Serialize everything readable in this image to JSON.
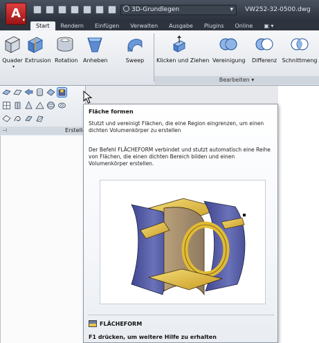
{
  "titlebar": {
    "app_letter": "A",
    "workspace_name": "3D-Grundlegen",
    "document_title": "VW252-32-0500.dwg"
  },
  "tabs": [
    {
      "label": "Start",
      "active": true
    },
    {
      "label": "Rendern",
      "active": false
    },
    {
      "label": "Einfügen",
      "active": false
    },
    {
      "label": "Verwalten",
      "active": false
    },
    {
      "label": "Ausgabe",
      "active": false
    },
    {
      "label": "Plugins",
      "active": false
    },
    {
      "label": "Online",
      "active": false
    },
    {
      "label": "▣ ▾",
      "active": false
    }
  ],
  "ribbon": {
    "buttons": [
      {
        "label": "Quader",
        "icon": "box-icon"
      },
      {
        "label": "Extrusion",
        "icon": "extrude-icon"
      },
      {
        "label": "Rotation",
        "icon": "revolve-icon"
      },
      {
        "label": "Anheben",
        "icon": "loft-icon"
      },
      {
        "label": "Sweep",
        "icon": "sweep-icon"
      },
      {
        "label": "Klicken und Ziehen",
        "icon": "presspull-icon"
      },
      {
        "label": "Vereinigung",
        "icon": "union-icon"
      },
      {
        "label": "Differenz",
        "icon": "subtract-icon"
      },
      {
        "label": "Schnittmeng",
        "icon": "intersect-icon"
      }
    ],
    "panel_title": "Bearbeiten ▾"
  },
  "left_panel": {
    "footer_label": "Erstelle",
    "pin": "⊣"
  },
  "tooltip": {
    "title": "Fläche formen",
    "summary": "Stutzt und vereinigt Flächen, die eine Region eingrenzen, um einen dichten Volumenkörper zu erstellen",
    "description": "Der Befehl FLÄCHEFORM verbindet und stutzt automatisch eine Reihe von Flächen, die einen dichten Bereich bilden und einen Volumenkörper erstellen.",
    "command": "FLÄCHEFORM",
    "help": "F1 drücken, um weitere Hilfe zu erhalten"
  },
  "colors": {
    "accent_red": "#c21e1e",
    "surface_blue": "#5a63a8",
    "surface_gold": "#e8c84a"
  }
}
